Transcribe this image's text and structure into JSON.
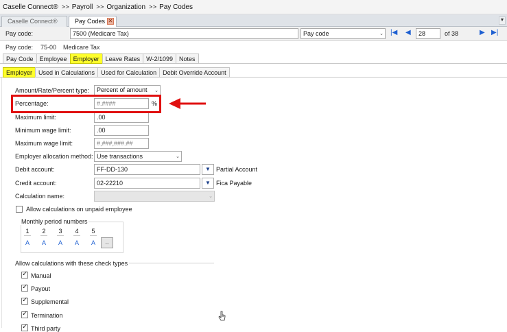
{
  "breadcrumb": {
    "items": [
      "Caselle Connect®",
      "Payroll",
      "Organization",
      "Pay Codes"
    ],
    "separator": "> >"
  },
  "doc_tabs": {
    "tab1": "Caselle Connect®",
    "tab2": "Pay Codes",
    "close_glyph": "✕",
    "scroll_glyph": "▼"
  },
  "selector": {
    "label": "Pay code:",
    "value": "7500 (Medicare Tax)",
    "lookup_by": "Pay code",
    "record": "28",
    "of_total": "of 38",
    "nav_first": "|◀",
    "nav_prev": "◀",
    "nav_next": "▶",
    "nav_last": "▶|"
  },
  "info": {
    "label": "Pay code:",
    "number": "75-00",
    "name": "Medicare Tax"
  },
  "section_tabs": [
    "Pay Code",
    "Employee",
    "Employer",
    "Leave Rates",
    "W-2/1099",
    "Notes"
  ],
  "sub_tabs": [
    "Employer",
    "Used in Calculations",
    "Used for Calculation",
    "Debit Override Account"
  ],
  "form": {
    "amount_type_label": "Amount/Rate/Percent type:",
    "amount_type_value": "Percent of amount",
    "percentage_label": "Percentage:",
    "percentage_placeholder": "#.####",
    "percent_sign": "%",
    "max_limit_label": "Maximum limit:",
    "max_limit_value": ".00",
    "min_wage_label": "Minimum wage limit:",
    "min_wage_value": ".00",
    "max_wage_label": "Maximum wage limit:",
    "max_wage_placeholder": "#,###,###.##",
    "allocation_label": "Employer allocation method:",
    "allocation_value": "Use transactions",
    "debit_label": "Debit account:",
    "debit_value": "FF-DD-130",
    "debit_desc": "Partial Account",
    "credit_label": "Credit account:",
    "credit_value": "02-22210",
    "credit_desc": "Fica Payable",
    "calc_name_label": "Calculation name:",
    "allow_unpaid_label": "Allow calculations on unpaid employee",
    "monthly_title": "Monthly period numbers",
    "monthly_numbers": [
      "1",
      "2",
      "3",
      "4",
      "5"
    ],
    "monthly_values": [
      "A",
      "A",
      "A",
      "A",
      "A"
    ],
    "more_label": "..",
    "check_types_title": "Allow calculations with these check types",
    "check_types": [
      "Manual",
      "Payout",
      "Supplemental",
      "Termination",
      "Third party"
    ],
    "lookup_glyph": "▼",
    "dropdown_glyph": "⌄"
  },
  "colors": {
    "active_tab": "#ffff2a",
    "annotation": "#e01010",
    "nav_blue": "#1d5fd1"
  }
}
